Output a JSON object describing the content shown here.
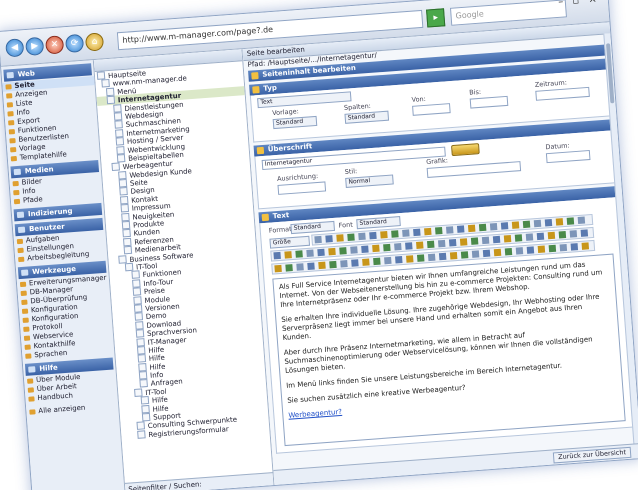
{
  "browser": {
    "url": "http://www.m-manager.com/page?.de",
    "search_placeholder": "Google"
  },
  "menu": {
    "sections": [
      {
        "title": "Web",
        "items": [
          "Seite",
          "Anzeigen",
          "Liste",
          "Info",
          "Export",
          "Funktionen",
          "Benutzerlisten",
          "Vorlage",
          "Templatehilfe"
        ]
      },
      {
        "title": "Medien",
        "items": [
          "Bilder",
          "Info",
          "Pfade"
        ]
      },
      {
        "title": "Indizierung",
        "items": []
      },
      {
        "title": "Benutzer",
        "items": [
          "Aufgaben",
          "Einstellungen",
          "Arbeitsbegleitung"
        ]
      },
      {
        "title": "Werkzeuge",
        "items": [
          "Erweiterungsmanager",
          "DB-Manager",
          "DB-Überprüfung",
          "Konfiguration",
          "Konfiguration",
          "Protokoll",
          "Webservice",
          "Kontakthilfe",
          "Sprachen"
        ]
      },
      {
        "title": "Hilfe",
        "items": [
          "Über Module",
          "Über Arbeit",
          "Handbuch"
        ]
      }
    ],
    "footer": "Alle anzeigen"
  },
  "tree": {
    "nodes": [
      "Hauptseite",
      "www.nm-manager.de",
      "Menü",
      "Internetagentur",
      "Dienstleistungen",
      "Webdesign",
      "Suchmaschinen",
      "Internetmarketing",
      "Hosting / Server",
      "Webentwicklung",
      "Beispieltabellen",
      "Werbeagentur",
      "Webdesign Kunde",
      "Seite",
      "Design",
      "Kontakt",
      "Impressum",
      "Neuigkeiten",
      "Produkte",
      "Kunden",
      "Referenzen",
      "Medienarbeit",
      "Business Software",
      "IT-Tool",
      "Funktionen",
      "Info-Tour",
      "Preise",
      "Module",
      "Versionen",
      "Demo",
      "Download",
      "Sprachversion",
      "IT-Manager",
      "Hilfe",
      "Hilfe",
      "Hilfe",
      "Info",
      "Anfragen",
      "IT-Tool",
      "Hilfe",
      "Hilfe",
      "Support",
      "Consulting Schwerpunkte",
      "Registrierungsformular"
    ],
    "selected_index": 3,
    "footer": "Seitenfilter / Suchen:"
  },
  "main": {
    "top_label": "Seite bearbeiten",
    "breadcrumb": "Pfad: /Hauptseite/.../Internetagentur/",
    "page_section_title": "Seiteninhalt bearbeiten",
    "type_section": {
      "title": "Typ",
      "type_value": "Text",
      "labels": [
        "Vorlage:",
        "Spalten:",
        "Von:",
        "Bis:",
        "Zeitraum:"
      ],
      "values": [
        "Standard",
        "Standard",
        "",
        "",
        ""
      ]
    },
    "heading_section": {
      "title": "Überschrift",
      "heading_value": "Internetagentur",
      "labels": [
        "Ausrichtung:",
        "Stil:",
        "Grafik:",
        "Datum:"
      ],
      "values": [
        "",
        "Normal",
        "",
        ""
      ]
    },
    "text_section": {
      "title": "Text",
      "format_label": "Format",
      "format_value": "Standard",
      "font_label": "Font",
      "font_value": "Standard",
      "size_value": "Größe",
      "paragraphs": [
        "Als Full Service Internetagentur bieten wir Ihnen umfangreiche Leistungen rund um das Internet. Von der Webseitenerstellung bis hin zu e-commerce Projekten: Consulting rund um Ihre Internetpräsenz oder Ihr e-commerce Projekt bzw. Ihrem Webshop.",
        "Sie erhalten Ihre individuelle Lösung. Ihre zugehörige Webdesign, Ihr Webhosting oder Ihre Serverpräsenz liegt immer bei unsere Hand und erhalten somit ein Angebot aus Ihren Kunden.",
        "Aber durch Ihre Präsenz Internetmarketing, wie allem in Betracht auf Suchmaschinenoptimierung oder Webservicelösung, können wir Ihnen die vollständigen Lösungen bieten.",
        "Im Menü links finden Sie unsere Leistungsbereiche im Bereich Internetagentur.",
        "Sie suchen zusätzlich eine kreative Werbeagentur?"
      ],
      "link_text": "Werbeagentur?"
    },
    "status_button": "Zurück zur Übersicht"
  },
  "colors": {
    "accent": "#3a62a6",
    "selection": "#dbe8c8"
  }
}
